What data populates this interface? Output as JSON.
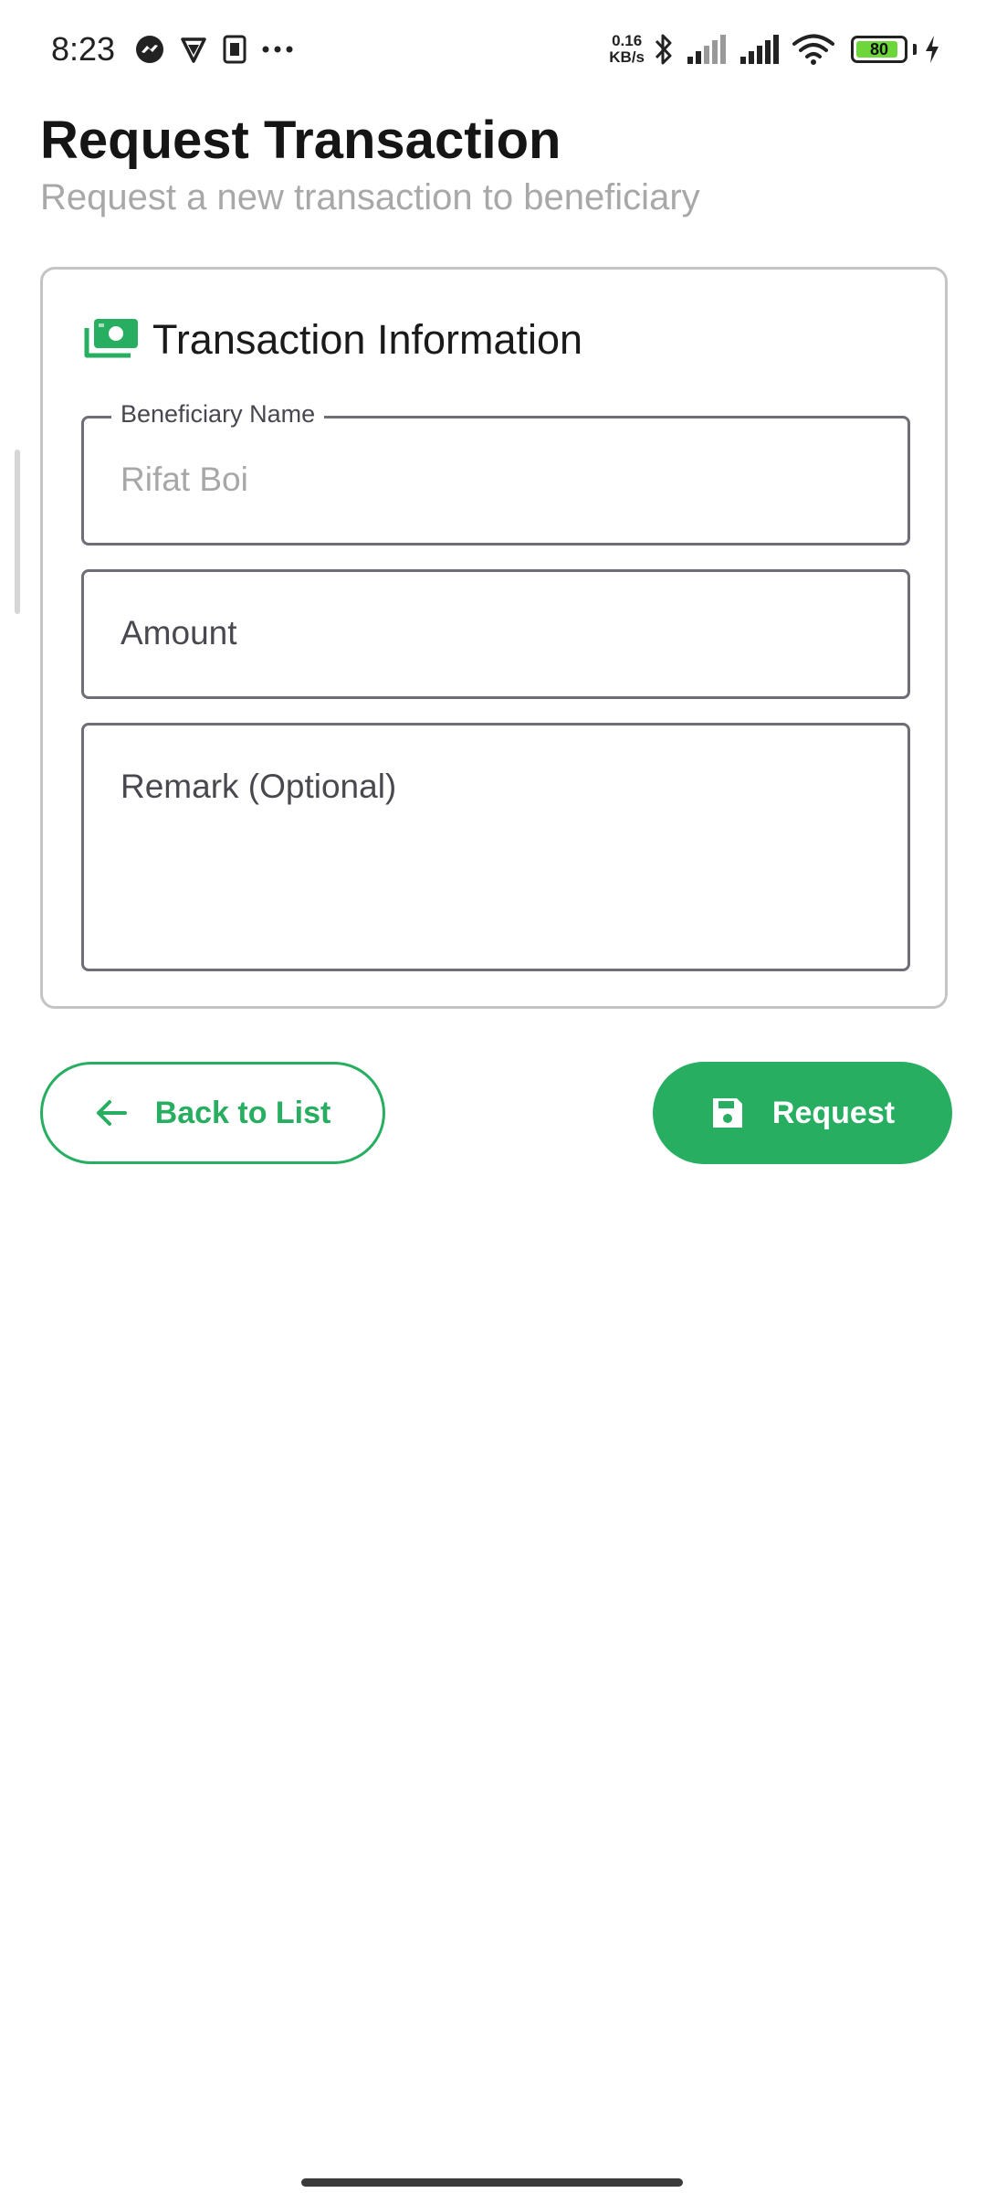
{
  "status_bar": {
    "time": "8:23",
    "net_speed_value": "0.16",
    "net_speed_unit": "KB/s",
    "battery_level": "80",
    "left_icons": [
      "messenger-icon",
      "vpn-icon",
      "sim-card-icon",
      "more-dots-icon"
    ],
    "right_icons": [
      "bluetooth-icon",
      "signal-bars-icon",
      "signal-bars-icon",
      "wifi-icon",
      "battery-icon",
      "charging-bolt-icon"
    ]
  },
  "header": {
    "title": "Request Transaction",
    "subtitle": "Request a new transaction to beneficiary"
  },
  "card": {
    "title": "Transaction Information",
    "icon": "money-icon",
    "fields": {
      "beneficiary": {
        "label": "Beneficiary Name",
        "value": "Rifat Boi"
      },
      "amount": {
        "placeholder": "Amount"
      },
      "remark": {
        "placeholder": "Remark (Optional)"
      }
    }
  },
  "buttons": {
    "back_label": "Back to List",
    "request_label": "Request"
  },
  "colors": {
    "accent": "#27ae60",
    "subtitle": "#a8a8a8",
    "field_border": "#6e6e76"
  }
}
